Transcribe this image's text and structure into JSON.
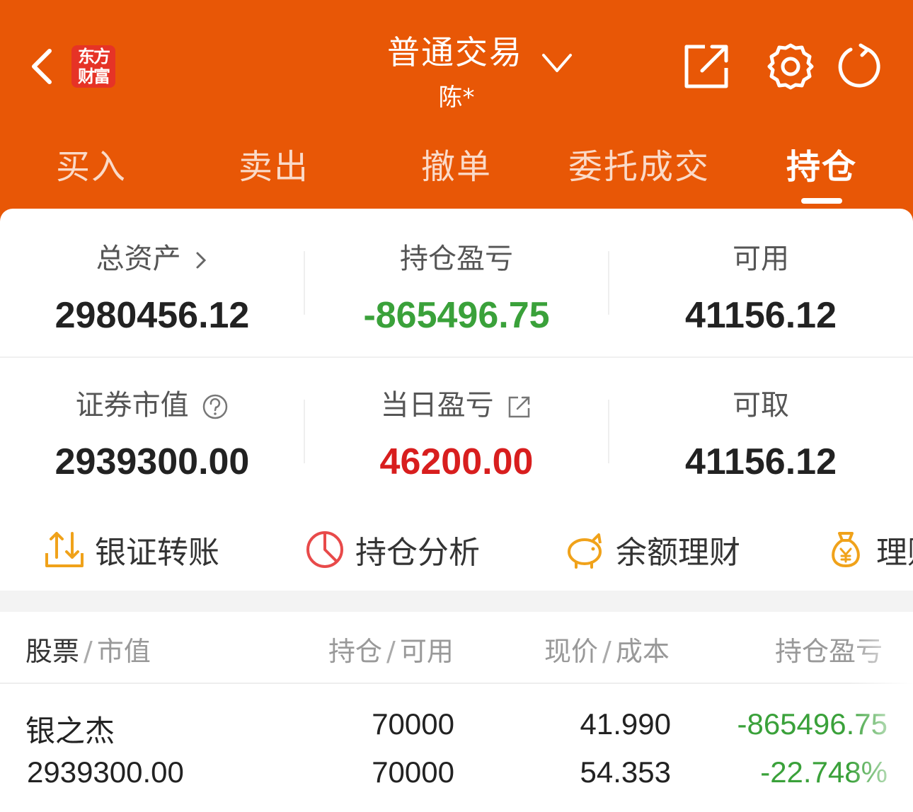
{
  "colors": {
    "brand": "#e85706",
    "loss": "#3aa13a",
    "gain": "#d81e1e"
  },
  "header": {
    "logo_line1": "东方",
    "logo_line2": "财富",
    "title": "普通交易",
    "account": "陈*",
    "icons": [
      "back-icon",
      "dropdown-chevron-icon",
      "share-icon",
      "settings-icon",
      "refresh-icon"
    ]
  },
  "tabs": [
    {
      "label": "买入"
    },
    {
      "label": "卖出"
    },
    {
      "label": "撤单"
    },
    {
      "label": "委托成交"
    },
    {
      "label": "持仓",
      "active": true
    }
  ],
  "summary": {
    "total_assets_label": "总资产",
    "total_assets": "2980456.12",
    "position_pl_label": "持仓盈亏",
    "position_pl": "-865496.75",
    "available_label": "可用",
    "available": "41156.12",
    "market_value_label": "证券市值",
    "market_value": "2939300.00",
    "daily_pl_label": "当日盈亏",
    "daily_pl": "46200.00",
    "withdrawable_label": "可取",
    "withdrawable": "41156.12"
  },
  "quick_actions": [
    {
      "label": "银证转账",
      "icon": "transfer-icon"
    },
    {
      "label": "持仓分析",
      "icon": "pie-chart-icon"
    },
    {
      "label": "余额理财",
      "icon": "piggy-bank-icon"
    },
    {
      "label": "理财",
      "icon": "money-bag-icon"
    }
  ],
  "table": {
    "headers": {
      "stock": "股票",
      "market_value": "市值",
      "position": "持仓",
      "available": "可用",
      "price": "现价",
      "cost": "成本",
      "pl": "持仓盈亏"
    },
    "rows": [
      {
        "name": "银之杰",
        "value": "2939300.00",
        "position": "70000",
        "available": "70000",
        "price": "41.990",
        "cost": "54.353",
        "pl": "-865496.75",
        "pl_pct": "-22.748%"
      }
    ]
  }
}
